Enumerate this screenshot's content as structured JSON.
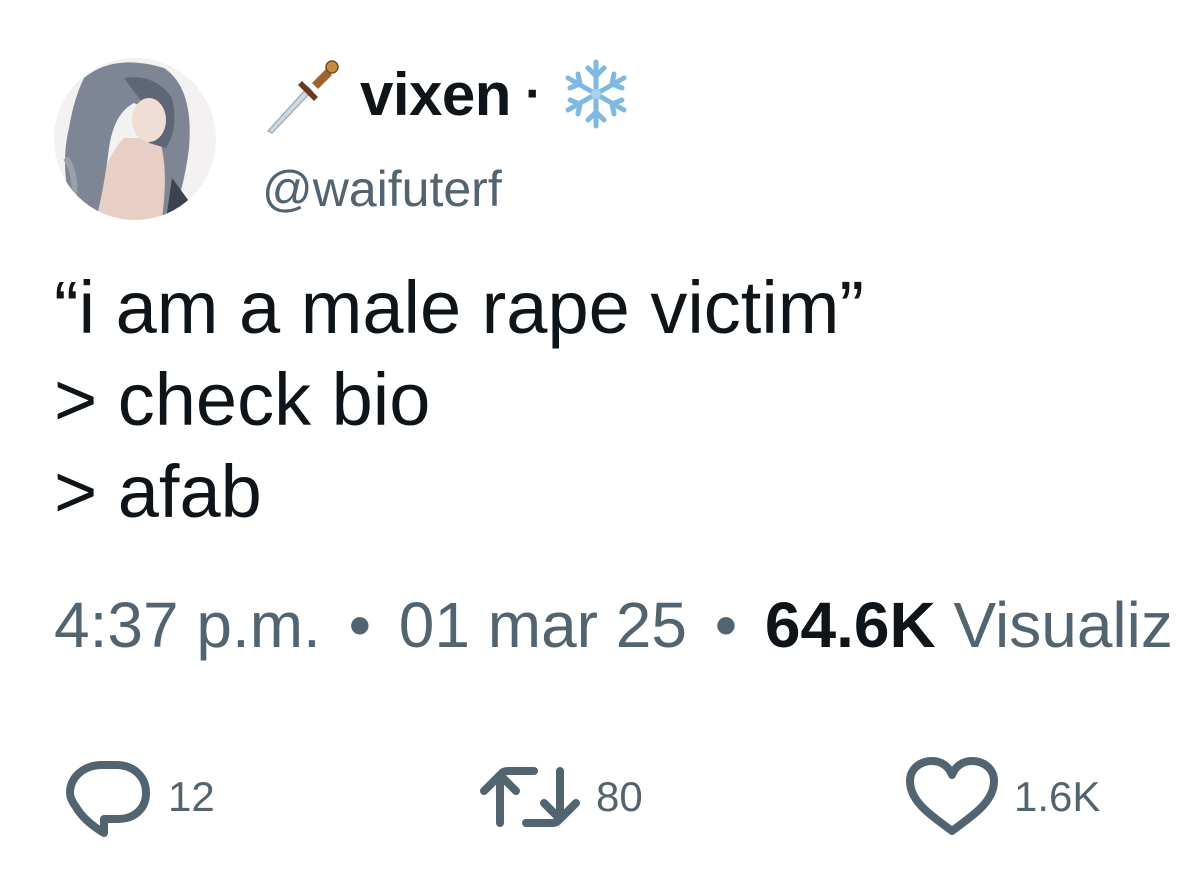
{
  "user": {
    "display_name": "vixen",
    "name_separator": "·",
    "handle": "@waifuterf",
    "name_emoji_left": "dagger-icon",
    "name_emoji_right": "snowflake-icon"
  },
  "tweet": {
    "lines": [
      "“i am a male rape victim”",
      "> check bio",
      "> afab"
    ]
  },
  "meta": {
    "time": "4:37 p.m.",
    "separator": "•",
    "date": "01 mar 25",
    "views_count": "64.6K",
    "views_label": "Visualiz"
  },
  "actions": {
    "replies": "12",
    "retweets": "80",
    "likes": "1.6K"
  },
  "colors": {
    "text_primary": "#0f1419",
    "text_secondary": "#536471",
    "background": "#ffffff"
  }
}
